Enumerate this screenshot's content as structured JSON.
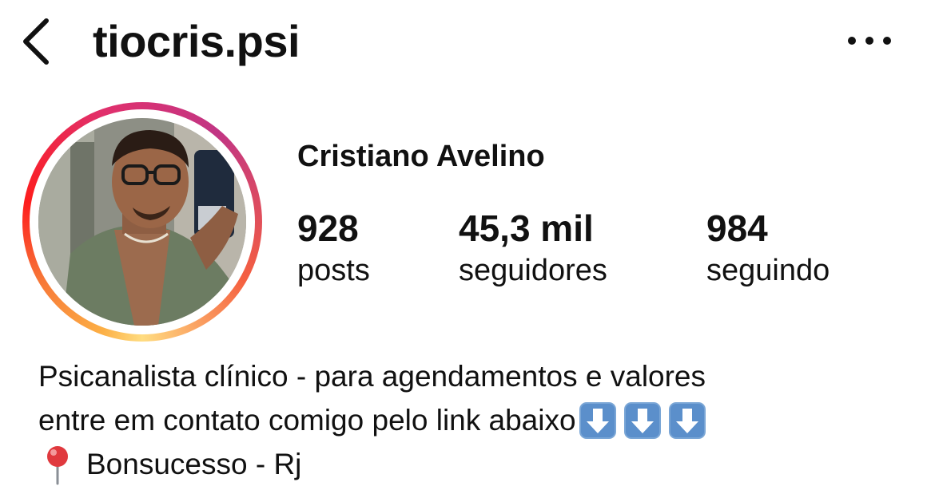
{
  "header": {
    "username": "tiocris.psi",
    "back_icon": "chevron-left-icon",
    "more_icon": "more-horizontal-icon"
  },
  "profile": {
    "display_name": "Cristiano Avelino",
    "avatar_ring_colors": [
      "#fcaf45",
      "#fd1d1d",
      "#e1306c",
      "#c13584"
    ],
    "stats": [
      {
        "value": "928",
        "label": "posts"
      },
      {
        "value": "45,3 mil",
        "label": "seguidores"
      },
      {
        "value": "984",
        "label": "seguindo"
      }
    ]
  },
  "bio": {
    "line1": "Psicanalista clínico - para agendamentos e valores",
    "line2": "entre em contato comigo pelo link abaixo",
    "line2_icons": [
      "down-arrow-icon",
      "down-arrow-icon",
      "down-arrow-icon"
    ],
    "line3_icon": "round-pushpin-icon",
    "line3": "Bonsucesso - Rj"
  }
}
